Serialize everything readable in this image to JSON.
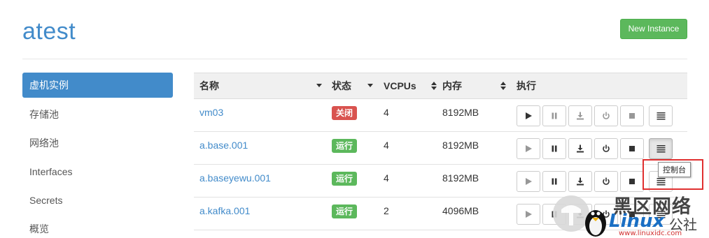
{
  "header": {
    "title": "atest",
    "new_instance_label": "New Instance"
  },
  "sidebar": {
    "items": [
      {
        "label": "虚机实例",
        "active": true
      },
      {
        "label": "存储池",
        "active": false
      },
      {
        "label": "网络池",
        "active": false
      },
      {
        "label": "Interfaces",
        "active": false
      },
      {
        "label": "Secrets",
        "active": false
      },
      {
        "label": "概览",
        "active": false
      }
    ]
  },
  "table": {
    "columns": [
      "名称",
      "状态",
      "VCPUs",
      "内存",
      "执行"
    ],
    "rows": [
      {
        "name": "vm03",
        "status": "关闭",
        "status_color": "#d9534f",
        "vcpus": "4",
        "memory": "8192MB"
      },
      {
        "name": "a.base.001",
        "status": "运行",
        "status_color": "#5cb85c",
        "vcpus": "4",
        "memory": "8192MB"
      },
      {
        "name": "a.baseyewu.001",
        "status": "运行",
        "status_color": "#5cb85c",
        "vcpus": "4",
        "memory": "8192MB"
      },
      {
        "name": "a.kafka.001",
        "status": "运行",
        "status_color": "#5cb85c",
        "vcpus": "2",
        "memory": "4096MB"
      }
    ],
    "action_icons": [
      "play-icon",
      "pause-icon",
      "download-icon",
      "power-icon",
      "stop-icon",
      "console-icon"
    ]
  },
  "tooltip": {
    "text": "控制台"
  },
  "watermark": {
    "cn": "黑区网络",
    "brand": "Linux",
    "suffix": "公社",
    "url": "www.linuxidc.com"
  },
  "colors": {
    "accent": "#428bca",
    "success": "#5cb85c",
    "danger": "#d9534f",
    "highlight_box": "#e03030"
  }
}
